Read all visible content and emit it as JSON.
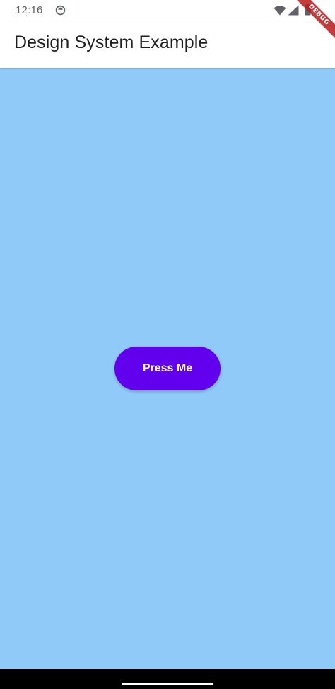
{
  "status_bar": {
    "time": "12:16",
    "icons": [
      "notification-icon",
      "wifi-icon",
      "signal-icon",
      "battery-icon"
    ]
  },
  "app_bar": {
    "title": "Design System Example"
  },
  "main": {
    "button_label": "Press Me"
  },
  "debug_banner": {
    "label": "DEBUG"
  },
  "colors": {
    "background": "#90caf9",
    "button": "#6200ee",
    "button_text": "#ffffff",
    "app_bar": "#ffffff",
    "debug_banner": "#b71c1c"
  }
}
